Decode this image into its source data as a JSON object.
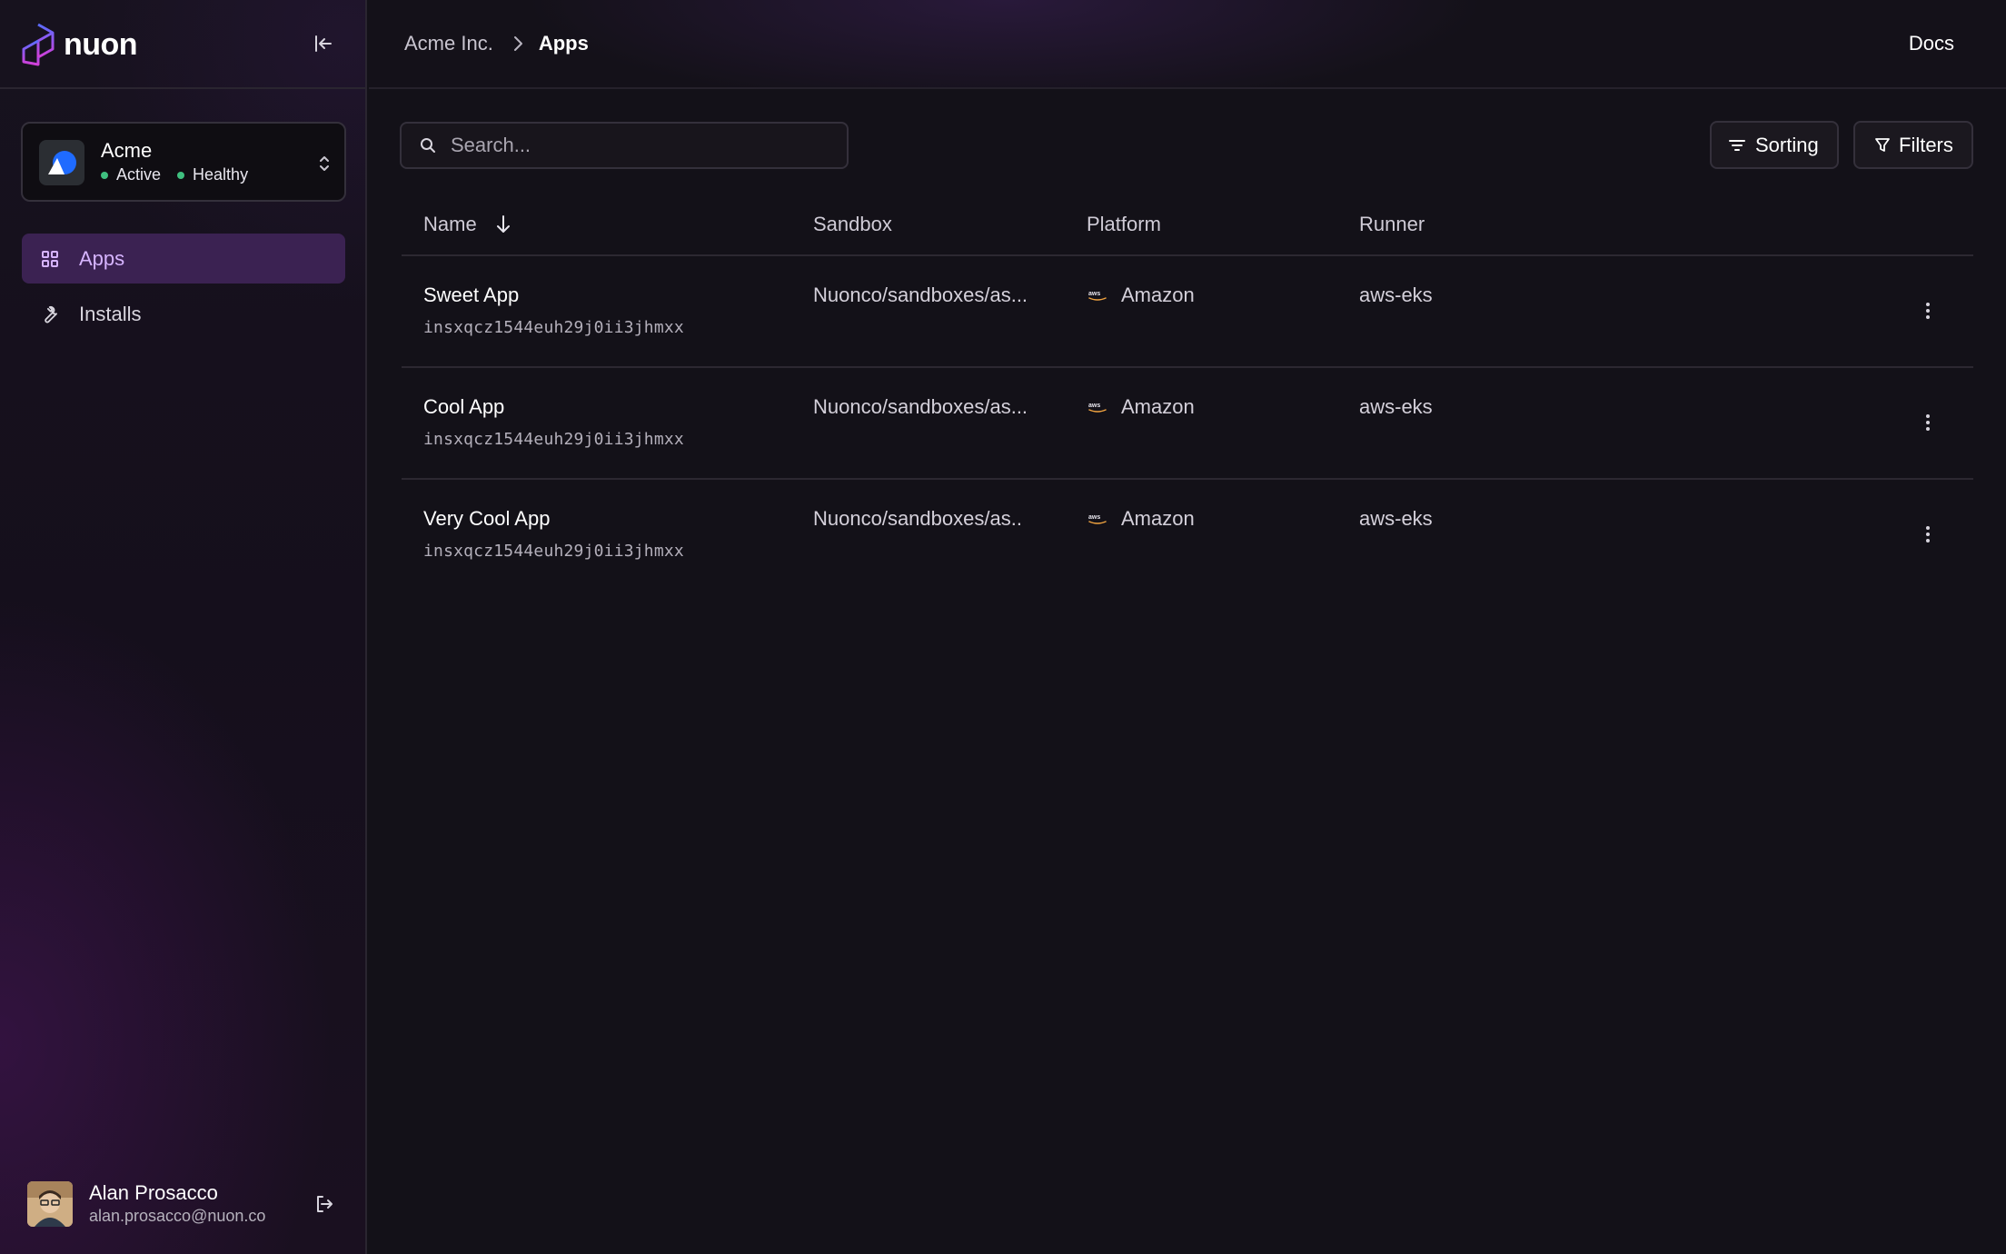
{
  "brand": {
    "name": "nuon"
  },
  "org": {
    "name": "Acme",
    "status": "Active",
    "health": "Healthy"
  },
  "nav": {
    "items": [
      {
        "label": "Apps",
        "icon": "grid-icon",
        "active": true
      },
      {
        "label": "Installs",
        "icon": "wrench-icon",
        "active": false
      }
    ]
  },
  "user": {
    "name": "Alan Prosacco",
    "email": "alan.prosacco@nuon.co"
  },
  "breadcrumb": {
    "org": "Acme Inc.",
    "current": "Apps"
  },
  "header": {
    "docs_label": "Docs"
  },
  "search": {
    "placeholder": "Search..."
  },
  "toolbar": {
    "sorting_label": "Sorting",
    "filters_label": "Filters"
  },
  "table": {
    "columns": [
      "Name",
      "Sandbox",
      "Platform",
      "Runner"
    ],
    "sort": {
      "column": "Name",
      "direction": "descending"
    },
    "rows": [
      {
        "name": "Sweet App",
        "id": "insxqcz1544euh29j0ii3jhmxx",
        "sandbox": "Nuonco/sandboxes/as...",
        "platform": "Amazon",
        "runner": "aws-eks"
      },
      {
        "name": "Cool App",
        "id": "insxqcz1544euh29j0ii3jhmxx",
        "sandbox": "Nuonco/sandboxes/as...",
        "platform": "Amazon",
        "runner": "aws-eks"
      },
      {
        "name": "Very Cool App",
        "id": "insxqcz1544euh29j0ii3jhmxx",
        "sandbox": "Nuonco/sandboxes/as..",
        "platform": "Amazon",
        "runner": "aws-eks"
      }
    ]
  },
  "colors": {
    "accent": "#d6b4ff",
    "active_nav_bg": "#3b2252",
    "status_green": "#3fbf7f",
    "aws_orange": "#f0a340"
  }
}
